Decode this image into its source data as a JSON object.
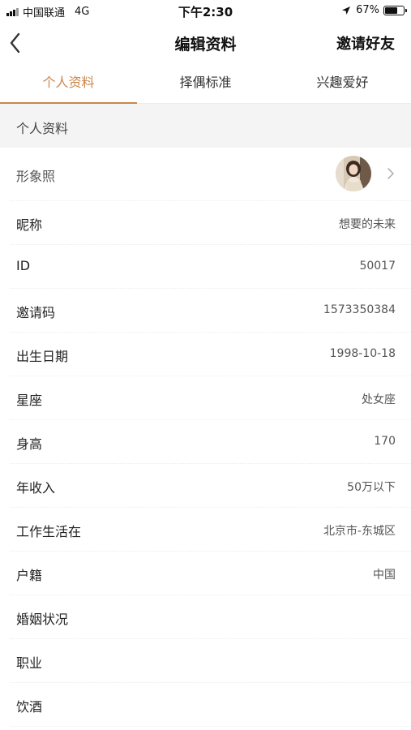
{
  "status_bar": {
    "carrier": "中国联通",
    "network": "4G",
    "time": "下午2:30",
    "battery": "67%"
  },
  "nav": {
    "title": "编辑资料",
    "invite": "邀请好友"
  },
  "tabs": [
    {
      "label": "个人资料",
      "active": true
    },
    {
      "label": "择偶标准",
      "active": false
    },
    {
      "label": "兴趣爱好",
      "active": false
    }
  ],
  "section": {
    "title": "个人资料"
  },
  "profile_photo": {
    "label": "形象照"
  },
  "fields": [
    {
      "label": "昵称",
      "value": "想要的未来"
    },
    {
      "label": "ID",
      "value": "50017"
    },
    {
      "label": "邀请码",
      "value": "1573350384"
    },
    {
      "label": "出生日期",
      "value": "1998-10-18"
    },
    {
      "label": "星座",
      "value": "处女座"
    },
    {
      "label": "身高",
      "value": "170"
    },
    {
      "label": "年收入",
      "value": "50万以下"
    },
    {
      "label": "工作生活在",
      "value": "北京市-东城区"
    },
    {
      "label": "户籍",
      "value": "中国"
    },
    {
      "label": "婚姻状况",
      "value": ""
    },
    {
      "label": "职业",
      "value": ""
    },
    {
      "label": "饮酒",
      "value": ""
    }
  ],
  "colors": {
    "accent": "#c9874d",
    "section_bg": "#f4f4f4"
  }
}
